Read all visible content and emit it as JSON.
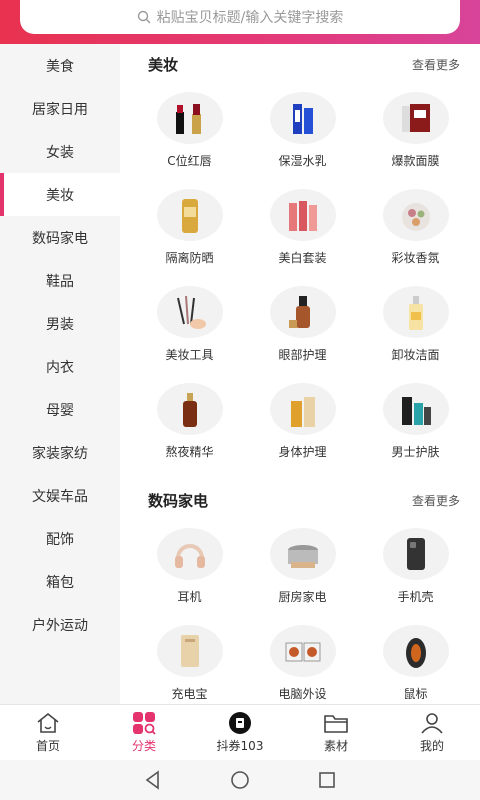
{
  "search": {
    "placeholder": "粘贴宝贝标题/输入关键字搜索",
    "icon": "search-icon"
  },
  "sidebar": {
    "items": [
      {
        "label": "美食"
      },
      {
        "label": "居家日用"
      },
      {
        "label": "女装"
      },
      {
        "label": "美妆",
        "active": true
      },
      {
        "label": "数码家电"
      },
      {
        "label": "鞋品"
      },
      {
        "label": "男装"
      },
      {
        "label": "内衣"
      },
      {
        "label": "母婴"
      },
      {
        "label": "家装家纺"
      },
      {
        "label": "文娱车品"
      },
      {
        "label": "配饰"
      },
      {
        "label": "箱包"
      },
      {
        "label": "户外运动"
      }
    ]
  },
  "sections": [
    {
      "title": "美妆",
      "more": "查看更多",
      "items": [
        {
          "label": "C位红唇"
        },
        {
          "label": "保湿水乳"
        },
        {
          "label": "爆款面膜"
        },
        {
          "label": "隔离防晒"
        },
        {
          "label": "美白套装"
        },
        {
          "label": "彩妆香氛"
        },
        {
          "label": "美妆工具"
        },
        {
          "label": "眼部护理"
        },
        {
          "label": "卸妆洁面"
        },
        {
          "label": "熬夜精华"
        },
        {
          "label": "身体护理"
        },
        {
          "label": "男士护肤"
        }
      ]
    },
    {
      "title": "数码家电",
      "more": "查看更多",
      "items": [
        {
          "label": "耳机"
        },
        {
          "label": "厨房家电"
        },
        {
          "label": "手机壳"
        },
        {
          "label": "充电宝"
        },
        {
          "label": "电脑外设"
        },
        {
          "label": "鼠标"
        }
      ]
    }
  ],
  "tabbar": {
    "tabs": [
      {
        "label": "首页",
        "icon": "home-icon"
      },
      {
        "label": "分类",
        "icon": "category-icon",
        "active": true
      },
      {
        "label": "抖券103",
        "icon": "douquan-icon"
      },
      {
        "label": "素材",
        "icon": "folder-icon"
      },
      {
        "label": "我的",
        "icon": "user-icon"
      }
    ]
  },
  "colors": {
    "accent": "#e3346e",
    "header_start": "#e8324f",
    "header_end": "#d8449a"
  }
}
